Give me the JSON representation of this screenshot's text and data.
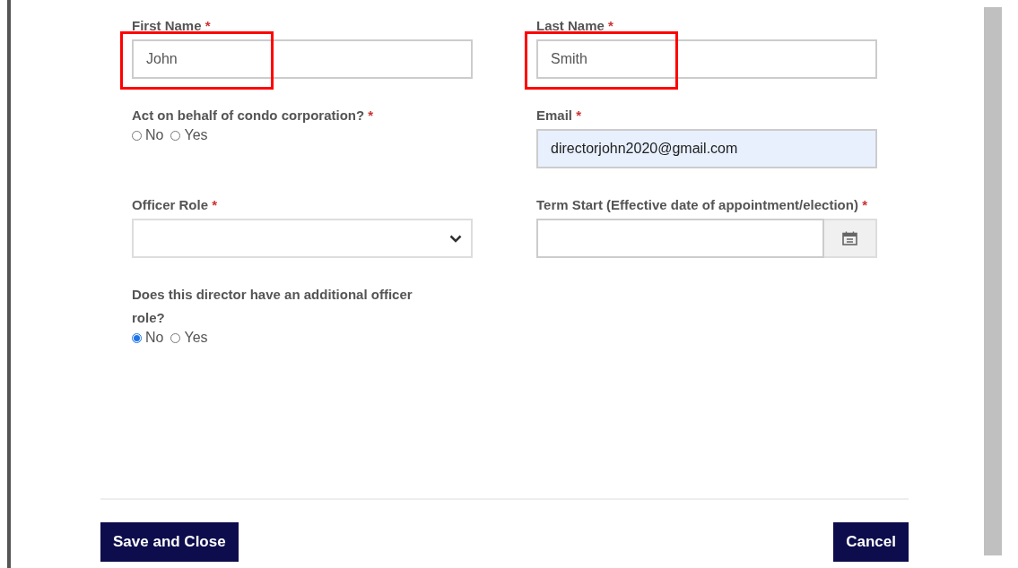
{
  "fields": [
    {
      "kind": "text",
      "label": "First Name",
      "marker": "*",
      "value": "John",
      "highlighted": true
    },
    {
      "kind": "text",
      "label": "Last Name",
      "marker": "*",
      "value": "Smith",
      "highlighted": true
    },
    {
      "kind": "radio",
      "label": "Act on behalf of condo corporation?",
      "marker": "*",
      "options": [
        {
          "label": "No",
          "selected": false
        },
        {
          "label": "Yes",
          "selected": false
        }
      ]
    },
    {
      "kind": "text",
      "label": "Email",
      "marker": "*",
      "value": "directorjohn2020@gmail.com",
      "autofilled": true
    },
    {
      "kind": "select",
      "label": "Officer Role",
      "marker": "*"
    },
    {
      "kind": "date",
      "label": "Term Start (Effective date of appointment/election)",
      "marker": "*"
    },
    {
      "kind": "radio",
      "label": "Does this director have an additional officer role?",
      "options": [
        {
          "label": "No",
          "selected": true
        },
        {
          "label": "Yes",
          "selected": false
        }
      ]
    }
  ],
  "buttons": [
    {
      "label": "Save and Close"
    },
    {
      "label": "Cancel"
    }
  ]
}
